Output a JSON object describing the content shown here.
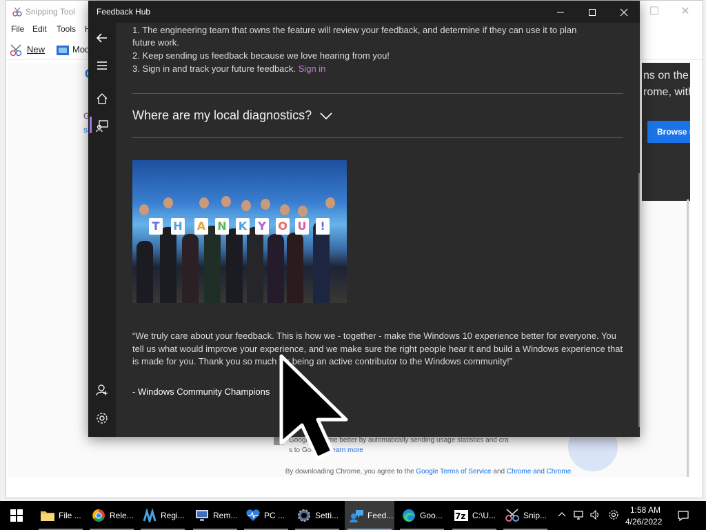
{
  "snipping_tool": {
    "title": "Snipping Tool",
    "menu": [
      "File",
      "Edit",
      "Tools",
      "H"
    ],
    "toolbar": {
      "new_label": "New",
      "mode_label": "Mod"
    }
  },
  "chrome_page": {
    "right_text_1": "ns on the",
    "right_text_2": "rome, with",
    "browse_button": "Browse s",
    "left_g": "G",
    "left_text_1": "Go",
    "left_text_2": "se",
    "consent_text": "Google Chrome better by automatically sending usage statistics and cra",
    "consent_text_2": "s to Google.",
    "learn_more": "Learn more",
    "terms_prefix": "By downloading Chrome, you agree to the",
    "terms_link_1": "Google Terms of Service",
    "terms_and": "and",
    "terms_link_2": "Chrome and Chrome OS Additional Terms of Service"
  },
  "feedback_hub": {
    "title": "Feedback Hub",
    "lines": {
      "line1a": "1. The engineering team that owns the feature will review your feedback, and determine if they can use it to plan",
      "line1b": "future work.",
      "line2": "2. Keep sending us feedback because we love hearing from you!",
      "line3": "3. Sign in and track your future feedback.",
      "signin_link": "Sign in"
    },
    "diagnostics_heading": "Where are my local diagnostics?",
    "photo_sign_letters": [
      "T",
      "H",
      "A",
      "N",
      "K",
      "Y",
      "O",
      "U",
      "!"
    ],
    "quote": "“We truly care about your feedback. This is how we - together - make the Windows 10 experience better for everyone. You tell us what would improve your experience, and we make sure the right people hear it and build a Windows experience that is made for you. Thank you so much for being an active contributor to the Windows community!”",
    "signature": "- Windows Community Champions"
  },
  "taskbar": {
    "items": [
      {
        "label": "File ...",
        "icon": "folder-icon"
      },
      {
        "label": "Rele...",
        "icon": "chrome-icon"
      },
      {
        "label": "Regi...",
        "icon": "registry-icon"
      },
      {
        "label": "Rem...",
        "icon": "remote-desktop-icon"
      },
      {
        "label": "PC ...",
        "icon": "pc-health-icon"
      },
      {
        "label": "Setti...",
        "icon": "settings-icon"
      },
      {
        "label": "Feed...",
        "icon": "feedback-hub-icon"
      },
      {
        "label": "Goo...",
        "icon": "edge-icon"
      },
      {
        "label": "C:\\U...",
        "icon": "7zip-icon"
      },
      {
        "label": "Snip...",
        "icon": "snipping-tool-icon"
      }
    ],
    "clock_time": "1:58 AM",
    "clock_date": "4/26/2022"
  },
  "colors": {
    "accent_purple": "#9b77e0",
    "signin_link": "#c77ddb",
    "chrome_blue": "#1a73e8"
  }
}
